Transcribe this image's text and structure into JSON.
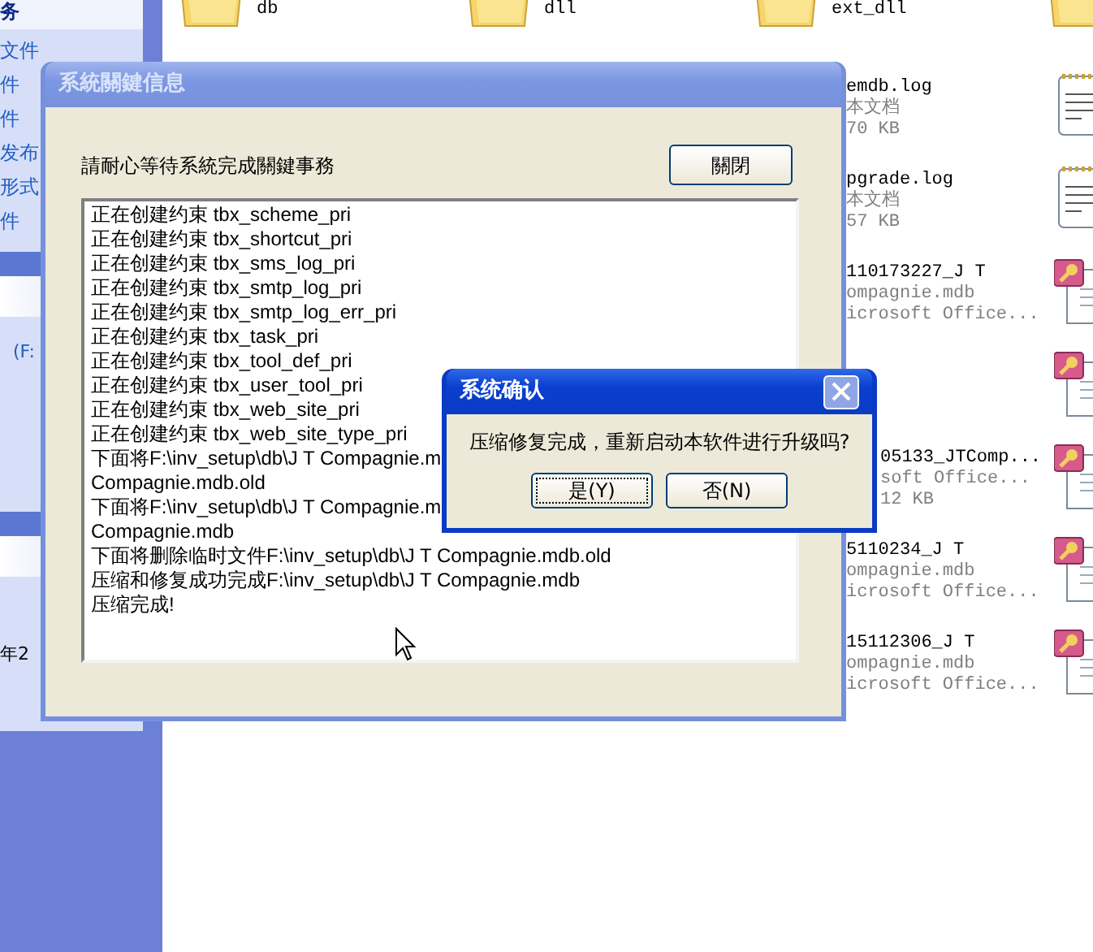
{
  "explorer": {
    "task_pane": {
      "header": "务",
      "items": [
        "文件",
        "件",
        "件",
        "发布",
        "形式",
        "件"
      ],
      "details": [
        "(F:",
        "年2"
      ]
    },
    "folders": [
      {
        "name": "db"
      },
      {
        "name": "dll"
      },
      {
        "name": "ext_dll"
      }
    ],
    "files": [
      {
        "kind": "text",
        "lines": [
          "emdb.log",
          "本文档",
          "70 KB"
        ]
      },
      {
        "kind": "text",
        "lines": [
          "pgrade.log",
          "本文档",
          "57 KB"
        ]
      },
      {
        "kind": "database",
        "lines": [
          "110173227_J T",
          "ompagnie.mdb",
          "icrosoft Office..."
        ]
      },
      {
        "kind": "database"
      },
      {
        "kind": "database",
        "lines": [
          "05133_JTComp...",
          "soft Office...",
          "12 KB"
        ]
      },
      {
        "kind": "database",
        "lines": [
          "5110234_J T",
          "ompagnie.mdb",
          "icrosoft Office..."
        ]
      },
      {
        "kind": "database",
        "lines": [
          "15112306_J T",
          "ompagnie.mdb",
          "icrosoft Office..."
        ]
      }
    ]
  },
  "main_dialog": {
    "title": "系統關鍵信息",
    "active": false,
    "message": "請耐心等待系統完成關鍵事務",
    "close_button": "關閉",
    "log": [
      "正在创建约束 tbx_scheme_pri",
      "正在创建约束 tbx_shortcut_pri",
      "正在创建约束 tbx_sms_log_pri",
      "正在创建约束 tbx_smtp_log_pri",
      "正在创建约束 tbx_smtp_log_err_pri",
      "正在创建约束 tbx_task_pri",
      "正在创建约束 tbx_tool_def_pri",
      "正在创建约束 tbx_user_tool_pri",
      "正在创建约束 tbx_web_site_pri",
      "正在创建约束 tbx_web_site_type_pri",
      "下面将F:\\inv_setup\\db\\J T Compagnie.m",
      "Compagnie.mdb.old",
      "下面将F:\\inv_setup\\db\\J T Compagnie.m",
      "Compagnie.mdb",
      "下面将删除临时文件F:\\inv_setup\\db\\J T Compagnie.mdb.old",
      "压缩和修复成功完成F:\\inv_setup\\db\\J T Compagnie.mdb",
      "压缩完成!"
    ]
  },
  "confirm_dialog": {
    "title": "系统确认",
    "active": true,
    "message": "压缩修复完成，重新启动本软件进行升级吗?",
    "buttons": [
      {
        "label": "是(Y)",
        "focused": true
      },
      {
        "label": "否(N)",
        "focused": false
      }
    ]
  }
}
